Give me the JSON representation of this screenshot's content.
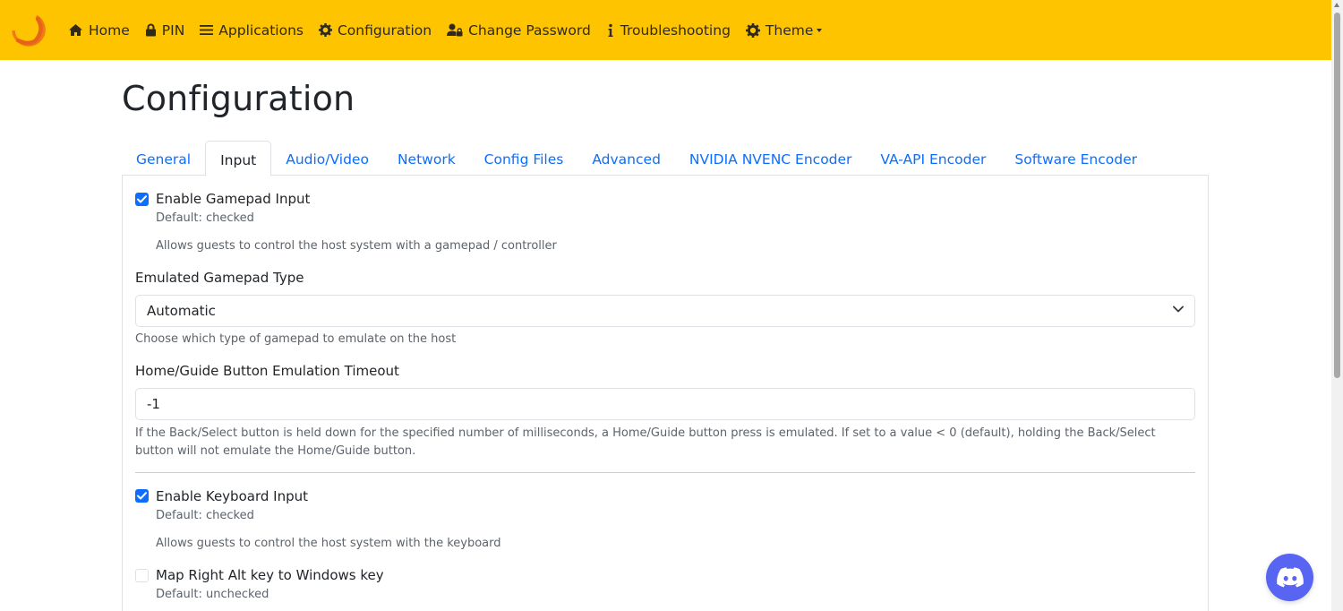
{
  "nav": {
    "items": [
      {
        "label": "Home",
        "icon": "home-icon"
      },
      {
        "label": "PIN",
        "icon": "lock-icon"
      },
      {
        "label": "Applications",
        "icon": "list-icon"
      },
      {
        "label": "Configuration",
        "icon": "gear-icon"
      },
      {
        "label": "Change Password",
        "icon": "user-lock-icon"
      },
      {
        "label": "Troubleshooting",
        "icon": "info-icon"
      },
      {
        "label": "Theme",
        "icon": "gear-icon"
      }
    ],
    "color": "#ffc400"
  },
  "page": {
    "title": "Configuration"
  },
  "tabs": [
    {
      "label": "General"
    },
    {
      "label": "Input"
    },
    {
      "label": "Audio/Video"
    },
    {
      "label": "Network"
    },
    {
      "label": "Config Files"
    },
    {
      "label": "Advanced"
    },
    {
      "label": "NVIDIA NVENC Encoder"
    },
    {
      "label": "VA-API Encoder"
    },
    {
      "label": "Software Encoder"
    }
  ],
  "active_tab": "Input",
  "settings": {
    "gamepad": {
      "label": "Enable Gamepad Input",
      "checked": true,
      "default": "Default: checked",
      "description": "Allows guests to control the host system with a gamepad / controller"
    },
    "gamepad_type": {
      "label": "Emulated Gamepad Type",
      "value": "Automatic",
      "description": "Choose which type of gamepad to emulate on the host"
    },
    "guide_timeout": {
      "label": "Home/Guide Button Emulation Timeout",
      "value": "-1",
      "description": "If the Back/Select button is held down for the specified number of milliseconds, a Home/Guide button press is emulated. If set to a value < 0 (default), holding the Back/Select button will not emulate the Home/Guide button."
    },
    "keyboard": {
      "label": "Enable Keyboard Input",
      "checked": true,
      "default": "Default: checked",
      "description": "Allows guests to control the host system with the keyboard"
    },
    "right_alt": {
      "label": "Map Right Alt key to Windows key",
      "checked": false,
      "default": "Default: unchecked"
    }
  },
  "accent_color": "#0d6efd",
  "discord_color": "#5865f2"
}
